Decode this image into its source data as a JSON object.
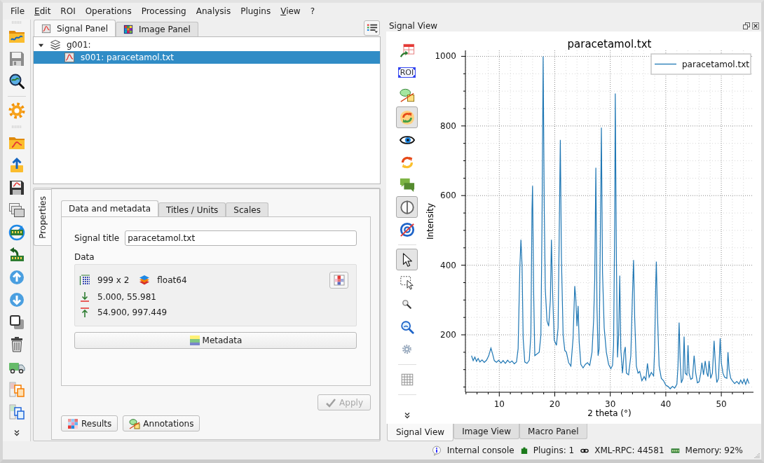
{
  "menu_bar": [
    {
      "label": "File",
      "underlined": false
    },
    {
      "label": "Edit",
      "underlined": true
    },
    {
      "label": "ROI",
      "underlined": false
    },
    {
      "label": "Operations",
      "underlined": false
    },
    {
      "label": "Processing",
      "underlined": false
    },
    {
      "label": "Analysis",
      "underlined": false
    },
    {
      "label": "Plugins",
      "underlined": false
    },
    {
      "label": "View",
      "underlined": true
    },
    {
      "label": "?",
      "underlined": false
    }
  ],
  "panel_tabs": [
    {
      "label": "Signal Panel",
      "selected": true
    },
    {
      "label": "Image Panel",
      "selected": false
    }
  ],
  "tree": [
    {
      "label": "g001:",
      "expanded": true,
      "selected": false,
      "children": [
        {
          "label": "s001: paracetamol.txt",
          "selected": true
        }
      ]
    }
  ],
  "properties": {
    "side_tabs": [
      {
        "label": "Properties",
        "selected": true
      }
    ],
    "tabs": [
      {
        "label": "Data and metadata",
        "selected": true
      },
      {
        "label": "Titles / Units",
        "selected": false
      },
      {
        "label": "Scales",
        "selected": false
      }
    ],
    "signal_title": {
      "label": "Signal title",
      "value": "paracetamol.txt"
    },
    "data": {
      "heading": "Data",
      "shape": "999 x 2",
      "dtype": "float64",
      "value_rows": [
        "5.000, 55.981",
        "54.900, 997.449"
      ]
    },
    "metadata_button": "Metadata",
    "apply_button": {
      "label": "Apply",
      "disabled": true
    },
    "bottom_buttons": [
      "Results",
      "Annotations"
    ]
  },
  "signal_view": {
    "title": "Signal View",
    "toolbar": [
      {
        "kind": "tool",
        "pressed": false
      },
      {
        "kind": "tool",
        "label": "ROI",
        "pressed": false
      },
      {
        "kind": "tool",
        "pressed": false
      },
      {
        "kind": "tool",
        "pressed": true
      },
      {
        "kind": "tool",
        "pressed": false
      },
      {
        "kind": "tool",
        "pressed": false
      },
      {
        "kind": "tool",
        "pressed": false
      },
      {
        "kind": "tool",
        "pressed": true
      },
      {
        "kind": "tool",
        "pressed": false
      },
      {
        "kind": "separator"
      },
      {
        "kind": "tool",
        "pressed": true
      },
      {
        "kind": "tool",
        "pressed": false
      },
      {
        "kind": "tool",
        "pressed": false
      },
      {
        "kind": "tool",
        "pressed": false
      },
      {
        "kind": "tool",
        "pressed": false
      },
      {
        "kind": "separator"
      },
      {
        "kind": "tool",
        "pressed": false
      },
      {
        "kind": "separator"
      }
    ],
    "plot": {
      "chart_data": {
        "type": "line",
        "title": "paracetamol.txt",
        "xlabel": "2 theta (°)",
        "ylabel": "Intensity",
        "grid": true,
        "xlim": [
          3.9,
          55.8
        ],
        "ylim": [
          35,
          1017
        ],
        "xticks": [
          10,
          20,
          30,
          40,
          50
        ],
        "yticks": [
          200,
          400,
          600,
          800,
          1000
        ],
        "x": [
          5.0,
          5.3,
          5.6,
          5.9,
          6.2,
          6.5,
          6.9,
          7.3,
          7.7,
          8.1,
          8.5,
          8.8,
          9.1,
          9.5,
          9.9,
          10.3,
          10.7,
          11.1,
          11.5,
          11.9,
          12.3,
          12.7,
          13.1,
          13.4,
          13.7,
          13.9,
          14.1,
          14.3,
          14.6,
          15.0,
          15.4,
          15.7,
          15.9,
          16.0,
          16.2,
          16.4,
          16.8,
          17.2,
          17.5,
          17.7,
          17.9,
          18.1,
          18.3,
          18.6,
          18.9,
          19.2,
          19.4,
          19.6,
          19.9,
          20.3,
          20.6,
          20.8,
          21.0,
          21.2,
          21.5,
          21.8,
          22.1,
          22.5,
          22.9,
          23.3,
          23.6,
          23.8,
          24.0,
          24.2,
          24.4,
          24.7,
          25.1,
          25.5,
          25.9,
          26.3,
          26.7,
          27.0,
          27.2,
          27.4,
          27.6,
          27.8,
          28.0,
          28.2,
          28.4,
          28.6,
          28.9,
          29.3,
          29.7,
          30.1,
          30.4,
          30.6,
          30.8,
          30.9,
          31.1,
          31.3,
          31.5,
          31.7,
          31.9,
          32.2,
          32.5,
          32.7,
          32.9,
          33.3,
          33.7,
          34.0,
          34.2,
          34.4,
          34.7,
          35.0,
          35.3,
          35.7,
          36.1,
          36.4,
          36.7,
          37.0,
          37.4,
          37.8,
          38.0,
          38.2,
          38.3,
          38.5,
          38.8,
          39.2,
          39.6,
          40.0,
          40.4,
          40.8,
          41.2,
          41.6,
          42.0,
          42.2,
          42.4,
          42.6,
          42.8,
          43.1,
          43.3,
          43.5,
          43.8,
          44.0,
          44.2,
          44.5,
          44.8,
          45.1,
          45.4,
          45.7,
          46.0,
          46.3,
          46.5,
          46.8,
          47.1,
          47.4,
          47.6,
          47.8,
          48.1,
          48.4,
          48.7,
          49.0,
          49.2,
          49.5,
          49.8,
          50.0,
          50.3,
          50.6,
          51.0,
          51.2,
          51.4,
          51.7,
          52.0,
          52.4,
          52.8,
          53.2,
          53.5,
          53.8,
          54.1,
          54.4,
          54.7,
          55.0
        ],
        "series": [
          {
            "name": "paracetamol.txt",
            "color": "#1f77b4",
            "values": [
              140,
              126,
              136,
              124,
              132,
              122,
              128,
              121,
              127,
              140,
              162,
              145,
              126,
              121,
              127,
              119,
              126,
              118,
              127,
              120,
              125,
              117,
              122,
              160,
              390,
              473,
              400,
              190,
              122,
              118,
              127,
              200,
              560,
              628,
              320,
              140,
              145,
              150,
              200,
              520,
              1000,
              560,
              330,
              240,
              225,
              300,
              473,
              330,
              185,
              170,
              220,
              480,
              760,
              420,
              200,
              155,
              150,
              120,
              110,
              190,
              340,
              300,
              225,
              283,
              180,
              115,
              105,
              115,
              120,
              112,
              150,
              240,
              360,
              680,
              280,
              140,
              160,
              460,
              795,
              380,
              220,
              150,
              115,
              103,
              112,
              170,
              520,
              893,
              420,
              135,
              200,
              370,
              160,
              90,
              150,
              165,
              90,
              85,
              140,
              320,
              415,
              250,
              110,
              90,
              95,
              68,
              80,
              70,
              118,
              78,
              92,
              82,
              160,
              350,
              410,
              260,
              110,
              75,
              68,
              55,
              52,
              45,
              52,
              47,
              58,
              110,
              235,
              120,
              62,
              75,
              195,
              90,
              85,
              170,
              90,
              72,
              75,
              140,
              90,
              62,
              65,
              90,
              120,
              85,
              125,
              90,
              80,
              125,
              75,
              90,
              183,
              95,
              63,
              75,
              190,
              120,
              90,
              78,
              75,
              150,
              100,
              75,
              68,
              60,
              66,
              59,
              70,
              60,
              72,
              58,
              73,
              60
            ]
          }
        ]
      }
    }
  },
  "view_tabs": [
    {
      "label": "Signal View",
      "selected": true
    },
    {
      "label": "Image View",
      "selected": false
    },
    {
      "label": "Macro Panel",
      "selected": false
    }
  ],
  "status_bar": [
    "Internal console",
    "Plugins: 1",
    "XML-RPC: 44581",
    "Memory: 92%"
  ]
}
